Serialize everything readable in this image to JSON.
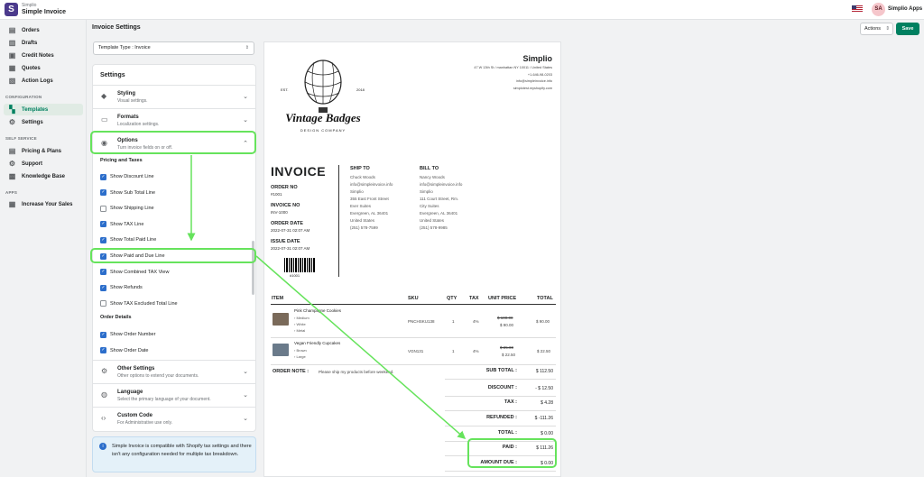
{
  "app": {
    "vendor": "Simplio",
    "name": "Simple Invoice",
    "logo_letter": "S"
  },
  "account": {
    "initials": "SA",
    "name": "Simplio Apps"
  },
  "sidebar": {
    "items": [
      {
        "label": "Orders",
        "icon": "orders-icon"
      },
      {
        "label": "Drafts",
        "icon": "drafts-icon"
      },
      {
        "label": "Credit Notes",
        "icon": "credit-notes-icon"
      },
      {
        "label": "Quotes",
        "icon": "quotes-icon"
      },
      {
        "label": "Action Logs",
        "icon": "action-logs-icon"
      }
    ],
    "config_heading": "CONFIGURATION",
    "config_items": [
      {
        "label": "Templates",
        "icon": "templates-icon"
      },
      {
        "label": "Settings",
        "icon": "gear-icon"
      }
    ],
    "self_heading": "SELF SERVICE",
    "self_items": [
      {
        "label": "Pricing & Plans",
        "icon": "pricing-icon"
      },
      {
        "label": "Support",
        "icon": "support-icon"
      },
      {
        "label": "Knowledge Base",
        "icon": "knowledge-icon"
      }
    ],
    "apps_heading": "APPS",
    "apps_items": [
      {
        "label": "Increase Your Sales",
        "icon": "sales-icon"
      }
    ]
  },
  "header": {
    "title": "Invoice Settings",
    "actions_label": "Actions",
    "save_label": "Save"
  },
  "template_select": {
    "value": "Template Type : Invoice"
  },
  "settings": {
    "title": "Settings",
    "styling": {
      "title": "Styling",
      "desc": "Visual settings."
    },
    "formats": {
      "title": "Formats",
      "desc": "Localization settings."
    },
    "options": {
      "title": "Options",
      "desc": "Turn invoice fields on or off."
    },
    "pricing_heading": "Pricing and Taxes",
    "pricing_items": [
      {
        "label": "Show Discount Line",
        "checked": true
      },
      {
        "label": "Show Sub Total Line",
        "checked": true
      },
      {
        "label": "Show Shipping Line",
        "checked": false
      },
      {
        "label": "Show TAX Line",
        "checked": true
      },
      {
        "label": "Show Total Paid Line",
        "checked": true
      },
      {
        "label": "Show Paid and Due Line",
        "checked": true
      },
      {
        "label": "Show Combined TAX View",
        "checked": true
      },
      {
        "label": "Show Refunds",
        "checked": true
      },
      {
        "label": "Show TAX Excluded Total Line",
        "checked": false
      }
    ],
    "order_heading": "Order Details",
    "order_items": [
      {
        "label": "Show Order Number",
        "checked": true
      },
      {
        "label": "Show Order Date",
        "checked": true
      }
    ],
    "other": {
      "title": "Other Settings",
      "desc": "Other options to extend your documents."
    },
    "language": {
      "title": "Language",
      "desc": "Select the primary language of your document."
    },
    "custom_code": {
      "title": "Custom Code",
      "desc": "For Administrative use only."
    }
  },
  "notice": {
    "text": "Simple Invoice is compatible with Shopify tax settings and there isn't any configuration needed for multiple tax breakdown."
  },
  "invoice": {
    "logo_text": "Vintage Badges",
    "logo_sub": "DESIGN COMPANY",
    "logo_est": "EST.",
    "logo_year": "2018",
    "company": "Simplio",
    "company_address": [
      "47 W 13th St / manhattan NY 10011 / United States",
      "+1-646-98-0203",
      "info@simpleinvoice.info",
      "simplotest.myshopify.com"
    ],
    "title": "INVOICE",
    "order_no_label": "ORDER NO",
    "order_no": "#1001",
    "invoice_no_label": "INVOICE NO",
    "invoice_no": "INV-1000",
    "order_date_label": "ORDER DATE",
    "order_date": "2022-07-31 02:07 AM",
    "issue_date_label": "ISSUE DATE",
    "issue_date": "2022-07-31 02:07 AM",
    "barcode_text": "#1001",
    "ship_to": {
      "label": "SHIP TO",
      "name": "Chuck Woods",
      "lines": [
        "info@simpleinvoice.info",
        "Simplio",
        "355 East Front Street",
        "Ever Suites",
        "Evergreen, AL 36401",
        "United States",
        "(251) 578-7599"
      ]
    },
    "bill_to": {
      "label": "BILL TO",
      "name": "Nancy Woods",
      "lines": [
        "info@simpleinvoice.info",
        "Simplio",
        "111 Court Street, Rm.",
        "City Suites",
        "Evergreen, AL 36401",
        "United States",
        "(251) 578-9985"
      ]
    },
    "columns": {
      "item": "ITEM",
      "sku": "SKU",
      "qty": "QTY",
      "tax": "TAX",
      "unit_price": "UNIT PRICE",
      "total": "TOTAL"
    },
    "lines": [
      {
        "name": "Pink Champagne Cookies",
        "variants": [
          "› Medium",
          "› White",
          "› Metal"
        ],
        "sku": "PNCHSKU138",
        "qty": "1",
        "tax": "4%",
        "old_price": "$ 100.00",
        "price": "$ 90.00",
        "total": "$ 90.00"
      },
      {
        "name": "Vegan Friendly Cupcakes",
        "variants": [
          "› Brown",
          "› Large"
        ],
        "sku": "VGN131",
        "qty": "1",
        "tax": "4%",
        "old_price": "$ 25.00",
        "price": "$ 22.50",
        "total": "$ 22.50"
      }
    ],
    "order_note_label": "ORDER NOTE :",
    "order_note": "Please ship my products before weekend.",
    "totals": [
      {
        "label": "SUB TOTAL :",
        "value": "$ 112.50"
      },
      {
        "label": "DISCOUNT :",
        "value": "- $ 12.50"
      },
      {
        "label": "TAX :",
        "value": "$ 4.28"
      },
      {
        "label": "REFUNDED :",
        "value": "$ -111.26"
      },
      {
        "label": "TOTAL :",
        "value": "$ 0.00"
      },
      {
        "label": "PAID :",
        "value": "$ 111.26"
      },
      {
        "label": "AMOUNT DUE :",
        "value": "$ 0.00"
      }
    ]
  },
  "colors": {
    "brand": "#4b3a8c",
    "save": "#008060",
    "highlight": "#66e35c",
    "checkbox": "#2c6ecb"
  }
}
